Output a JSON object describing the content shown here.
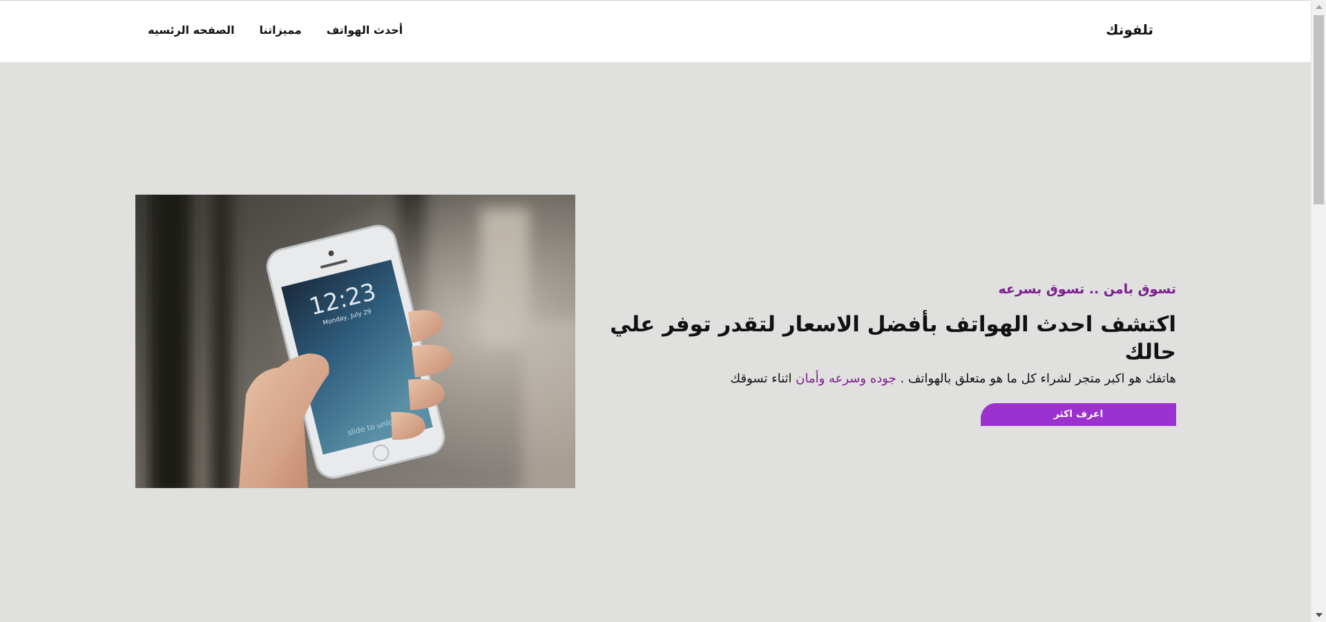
{
  "nav": {
    "brand": "تلفونك",
    "links": [
      "الصفحه الرئسيه",
      "مميزاتنا",
      "أحدث الهواتف"
    ]
  },
  "hero": {
    "tagline": "تسوق بامن .. تسوق بسرعه",
    "headline": "اكتشف احدث الهواتف بأفضل الاسعار لتقدر توفر علي حالك",
    "description_start": "هاتفك هو اكبر متجر لشراء كل ما هو متعلق بالهواتف . ",
    "description_highlight": "جوده وسرعه وأمان",
    "description_end": " اثناء تسوقك",
    "cta_label": "اعرف اكثر",
    "photo": {
      "icon": "smartphone-photo",
      "lock_time": "12:23",
      "lock_date": "Monday, July 29",
      "lock_hint": "slide to unlock"
    }
  },
  "colors": {
    "accent": "#9b31cf",
    "accent_text": "#7c1c8f",
    "background": "#e0e0df",
    "navbar": "#ffffff"
  }
}
